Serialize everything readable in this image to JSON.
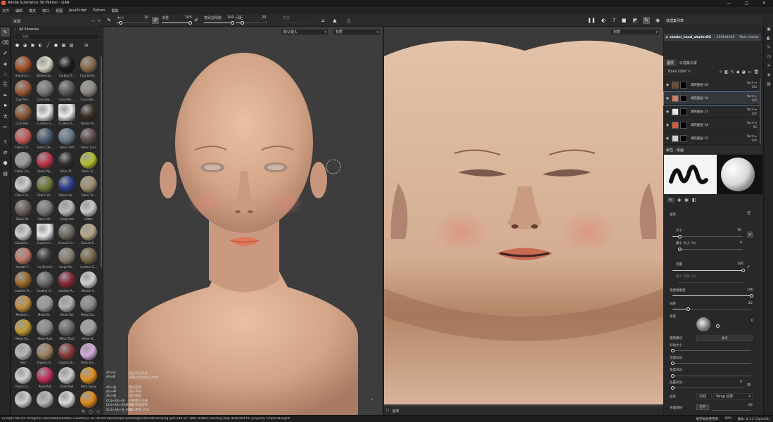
{
  "window": {
    "title": "Adobe Substance 3D Painter - LIAN",
    "buttons": [
      "—",
      "▢",
      "✕"
    ]
  },
  "menu": [
    "文件",
    "编辑",
    "模式",
    "窗口",
    "视图",
    "JavaScript",
    "Python",
    "帮助"
  ],
  "toolbar": {
    "size_label": "大小",
    "size_value": "10",
    "size_level": 0.1,
    "flow_label": "流量",
    "flow_value": "100",
    "flow_level": 1.0,
    "stroke_opacity_label": "笔刷透明度",
    "stroke_opacity_value": "100",
    "stroke_opacity_level": 1.0,
    "spacing_label": "间距",
    "spacing_value": "20",
    "spacing_level": 0.2,
    "angle_label": "角度"
  },
  "left_tools": [
    "brush",
    "eraser",
    "projection",
    "geometry-fill",
    "smudge",
    "clone",
    "picker",
    "selection",
    "bake",
    "measure"
  ],
  "assets": {
    "title": "资源",
    "library": "All libraries",
    "search_placeholder": "搜索",
    "items": [
      {
        "name": "Autumn L...",
        "color": "#a5522a"
      },
      {
        "name": "Baked Lig...",
        "color": "#d9d4c6"
      },
      {
        "name": "Carbon Fi...",
        "color": "#1a1a1a"
      },
      {
        "name": "Clay Earth...",
        "color": "#8a6a4c"
      },
      {
        "name": "Clay Terr...",
        "color": "#9c5a3a"
      },
      {
        "name": "Concrete ...",
        "color": "#7c7a76"
      },
      {
        "name": "Concrete ...",
        "color": "#5c5c5c"
      },
      {
        "name": "Concrete ...",
        "color": "#8f8c84"
      },
      {
        "name": "Cork Nat...",
        "color": "#8c5a36"
      },
      {
        "name": "Custom S...",
        "color": "#e8e8e8"
      },
      {
        "name": "Custom S...",
        "color": "#eeeeee"
      },
      {
        "name": "Denim Ri...",
        "color": "#3a3026"
      },
      {
        "name": "Fabric Co...",
        "color": "#c85a5a"
      },
      {
        "name": "Fabric De...",
        "color": "#4e5c72"
      },
      {
        "name": "Fabric Felt",
        "color": "#6a7a8c"
      },
      {
        "name": "Fabric Lace",
        "color": "#5c4a4c"
      },
      {
        "name": "Fabric Lin...",
        "color": "#9a9a9a"
      },
      {
        "name": "Fabric Ny...",
        "color": "#c0354a"
      },
      {
        "name": "Fabric Pl...",
        "color": "#2e2e2e"
      },
      {
        "name": "Fabric Ri...",
        "color": "#b4c02e"
      },
      {
        "name": "Fabric Se...",
        "color": "#cfcfcf"
      },
      {
        "name": "Fabric Sil...",
        "color": "#6e7c3a"
      },
      {
        "name": "Fabric So...",
        "color": "#2a3e8c"
      },
      {
        "name": "Fabric Te...",
        "color": "#a09070"
      },
      {
        "name": "Fabric W...",
        "color": "#6a5e58"
      },
      {
        "name": "Fabric W...",
        "color": "#7a7a7a"
      },
      {
        "name": "Footprints",
        "color": "#b8b8b8"
      },
      {
        "name": "Glitter",
        "color": "#c8c8c8"
      },
      {
        "name": "Gouache ...",
        "color": "#cfcfcf"
      },
      {
        "name": "Graphic tr...",
        "color": "#eaeaea"
      },
      {
        "name": "Ground Gr...",
        "color": "#6e6a60"
      },
      {
        "name": "Ground S...",
        "color": "#b8a888"
      },
      {
        "name": "Human F...",
        "color": "#c07a6a"
      },
      {
        "name": "Ivy Branch",
        "color": "#3a3a3a"
      },
      {
        "name": "Large Ro...",
        "color": "#8a7e72"
      },
      {
        "name": "Leather G...",
        "color": "#7a6a4a"
      },
      {
        "name": "Leather B...",
        "color": "#9a6a2a"
      },
      {
        "name": "Leather S...",
        "color": "#6a6a6a"
      },
      {
        "name": "Leather R...",
        "color": "#8a2a3a"
      },
      {
        "name": "Marble V...",
        "color": "#d0d0d0"
      },
      {
        "name": "Medium ...",
        "color": "#c09040"
      },
      {
        "name": "Metal Br...",
        "color": "#9a9a9a"
      },
      {
        "name": "Metal Foil",
        "color": "#b0b0b0"
      },
      {
        "name": "Metal Ga...",
        "color": "#8a8a8a"
      },
      {
        "name": "Metal Foi...",
        "color": "#c09a30"
      },
      {
        "name": "Metal Rust",
        "color": "#8a8a8a"
      },
      {
        "name": "Metal Rust",
        "color": "#6a6a6a"
      },
      {
        "name": "Metal W...",
        "color": "#a0a0a0"
      },
      {
        "name": "Nail",
        "color": "#b8b8b8"
      },
      {
        "name": "Organic B...",
        "color": "#a08060"
      },
      {
        "name": "Organic B...",
        "color": "#8a3a3a"
      },
      {
        "name": "Paint Bru...",
        "color": "#d4aadc"
      },
      {
        "name": "Paint Cra...",
        "color": "#d0d0d0"
      },
      {
        "name": "Paint Roll",
        "color": "#c0305a"
      },
      {
        "name": "Paint Roll",
        "color": "#c8c8c8"
      },
      {
        "name": "Paint Spray",
        "color": "#e09020"
      },
      {
        "name": "Paper Co...",
        "color": "#cfcfcf"
      },
      {
        "name": "Paper Gr...",
        "color": "#b8b8b8"
      },
      {
        "name": "Pebble...",
        "color": "#d8d8d8"
      },
      {
        "name": "Plan Spe...",
        "color": "#e08a20"
      }
    ]
  },
  "viewport_3d": {
    "camera": "默认镜头",
    "channel": "材质",
    "shortcuts": [
      {
        "key": "Alt+Q",
        "desc": "独立的层次遮"
      },
      {
        "key": "Alt+B",
        "desc": "隐藏/显现静态几何体"
      },
      {
        "key": "Alt+左",
        "desc": "镜头旋转"
      },
      {
        "key": "Alt+中",
        "desc": "镜头平移"
      },
      {
        "key": "Alt+右",
        "desc": "镜头缩放"
      },
      {
        "key": "Ctrl+Alt+左",
        "desc": "切换镜头选择"
      },
      {
        "key": "Ctrl+Alt+Shift+左",
        "desc": "镜头快速旋转"
      },
      {
        "key": "Ctrl+Alt+左 (Alt)",
        "desc": "镜头平移 (Alt)"
      }
    ]
  },
  "viewport_2d": {
    "channel": "材质",
    "footer_label": "速率"
  },
  "texture_set_list": {
    "title": "纹理集列表",
    "set_name": "shader_head_shaderSG",
    "resolution": "4096x4096",
    "shader": "Main shader"
  },
  "layers": {
    "tabs": [
      "图层",
      "纹理集设置"
    ],
    "channel": "Base color",
    "items": [
      {
        "name": "填充图层 20",
        "color": "#6a4a34",
        "blend": "Norm",
        "opacity": "100",
        "selected": false
      },
      {
        "name": "填充图层 19",
        "color": "#d08060",
        "blend": "Norm",
        "opacity": "100",
        "selected": true
      },
      {
        "name": "填充图层 17",
        "color": "#e8e8e8",
        "blend": "Norm",
        "opacity": "100",
        "selected": false
      },
      {
        "name": "填充图层 16",
        "color": "#d06040",
        "blend": "Norm",
        "opacity": "80",
        "selected": false
      },
      {
        "name": "填充图层 15",
        "color": "#cfcfcf",
        "blend": "Norm",
        "opacity": "100",
        "selected": false
      }
    ]
  },
  "properties": {
    "title": "属性 - 绘画",
    "section": "画笔",
    "size_label": "大小",
    "size_value": "10",
    "size_level": 0.1,
    "min_size_label": "最小 大小 (%)",
    "min_size_value": "0",
    "flow_label": "流量",
    "flow_value": "100",
    "flow_level": 1.0,
    "min_flow_label": "最小 流量 (%)",
    "stroke_opacity_label": "笔刷透明度",
    "stroke_opacity_value": "100",
    "stroke_opacity_level": 1.0,
    "spacing_label": "间距",
    "spacing_value": "20",
    "spacing_level": 0.2,
    "angle_label": "角度",
    "angle_value": "0",
    "follow_path_label": "跟随路径",
    "follow_path_value": "关闭",
    "size_jitter_label": "抖动大小",
    "flow_jitter_label": "流量抖动",
    "angle_jitter_label": "角度抖动",
    "position_jitter_label": "位置抖动",
    "position_jitter_value": "0",
    "projection_label": "投影",
    "projection_mode": "切线",
    "projection_wrap": "Wrap 投影",
    "backface_label": "背面剔除",
    "backface_value": "打开",
    "backface_angle": "90"
  },
  "status": {
    "message": "[Script] file:///C:/Program Files/Adobe/Adobe Substance 3D Painter/qml/QtQuick/Dialogs/DefaultFileDialog.qml:309:21: QML Button: Binding loop detected for property \"implicitHeight\"",
    "cache_label": "缓存磁盘使用率:",
    "cache_value": "82%",
    "version": "版本: 8.1.2 (OpenGL)"
  }
}
